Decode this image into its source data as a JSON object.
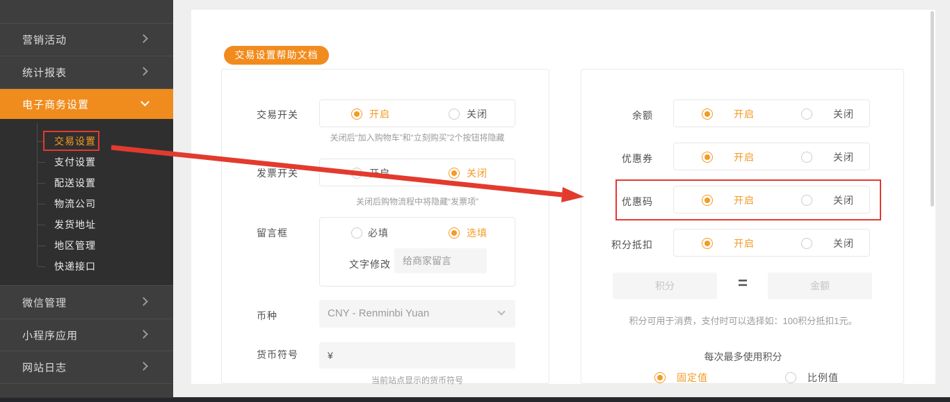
{
  "colors": {
    "accent": "#f59a23",
    "active_bg": "#f08c1e",
    "annotation_red": "#e23b2e"
  },
  "sidebar": {
    "items_top": [
      {
        "label": "营销活动"
      },
      {
        "label": "统计报表"
      }
    ],
    "active": {
      "label": "电子商务设置"
    },
    "submenu": [
      {
        "label": "交易设置"
      },
      {
        "label": "支付设置"
      },
      {
        "label": "配送设置"
      },
      {
        "label": "物流公司"
      },
      {
        "label": "发货地址"
      },
      {
        "label": "地区管理"
      },
      {
        "label": "快递接口"
      }
    ],
    "items_bottom": [
      {
        "label": "微信管理"
      },
      {
        "label": "小程序应用"
      },
      {
        "label": "网站日志"
      }
    ]
  },
  "help_button": {
    "label": "交易设置帮助文档"
  },
  "trade_card": {
    "trade_switch": {
      "label": "交易开关",
      "on": "开启",
      "off": "关闭",
      "note": "关闭后“加入购物车”和“立刻购买”2个按钮将隐藏"
    },
    "invoice_switch": {
      "label": "发票开关",
      "on": "开启",
      "off": "关闭",
      "note": "关闭后购物流程中将隐藏“发票项”"
    },
    "message_box": {
      "label": "留言框",
      "required": "必填",
      "optional": "选填",
      "edit_label": "文字修改",
      "text_value": "给商家留言"
    },
    "currency": {
      "label": "币种",
      "value": "CNY - Renminbi Yuan"
    },
    "currency_symbol": {
      "label": "货币符号",
      "value": "¥",
      "note": "当前站点显示的货币符号"
    }
  },
  "promo_card": {
    "balance": {
      "label": "余额",
      "on": "开启",
      "off": "关闭"
    },
    "coupon": {
      "label": "优惠券",
      "on": "开启",
      "off": "关闭"
    },
    "promo_code": {
      "label": "优惠码",
      "on": "开启",
      "off": "关闭"
    },
    "points_deduction": {
      "label": "积分抵扣",
      "on": "开启",
      "off": "关闭"
    },
    "points_rate": {
      "points_placeholder": "积分",
      "equals": "=",
      "amount_placeholder": "金额",
      "note": "积分可用于消费，支付时可以选择如：100积分抵扣1元。"
    },
    "max_points": {
      "label": "每次最多使用积分",
      "fixed": "固定值",
      "ratio": "比例值"
    }
  }
}
